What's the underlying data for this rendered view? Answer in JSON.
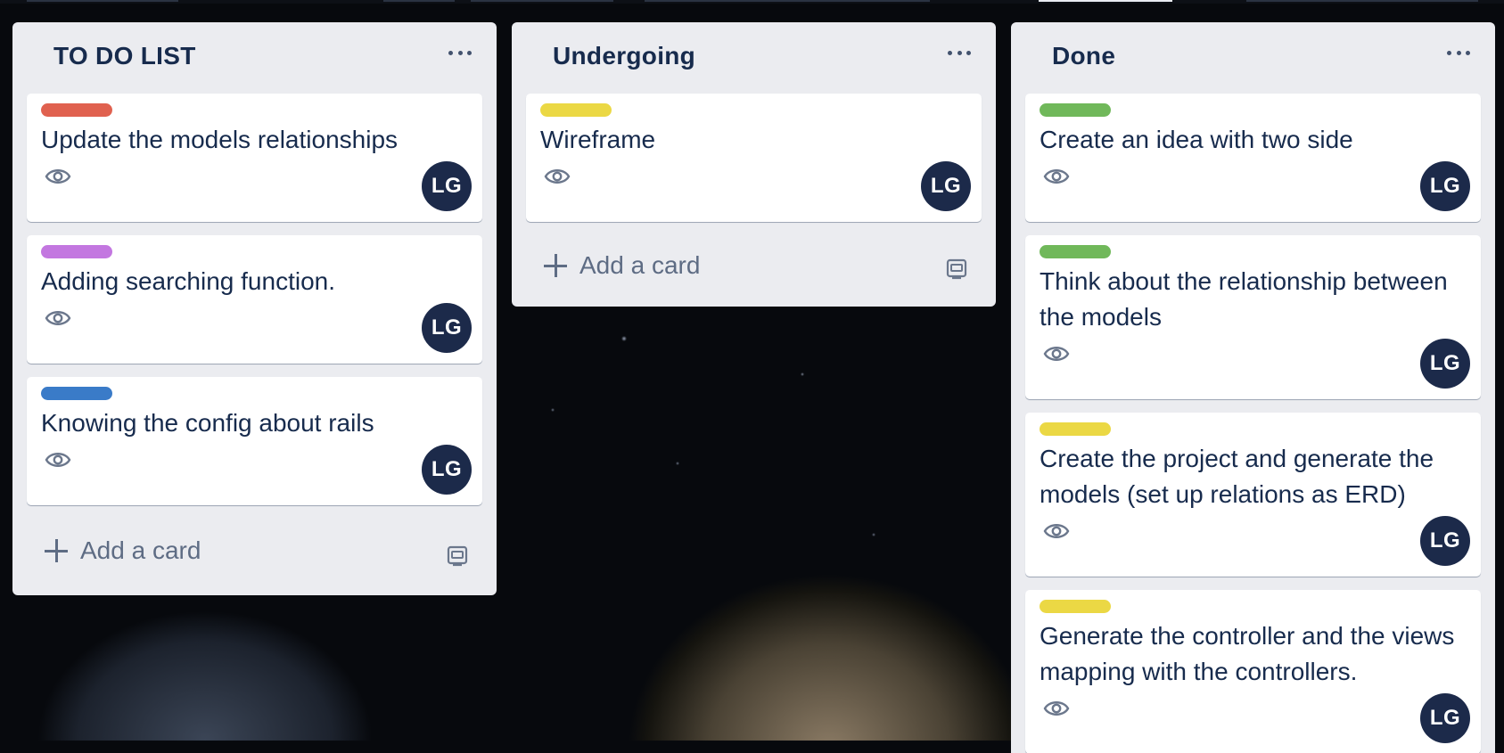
{
  "lists": [
    {
      "title": "TO DO LIST",
      "add_label": "Add a card",
      "cards": [
        {
          "label_color": "#e0614f",
          "title": "Update the models relationships",
          "avatar": "LG"
        },
        {
          "label_color": "#c377e0",
          "title": "Adding searching function.",
          "avatar": "LG"
        },
        {
          "label_color": "#3a7bc8",
          "title": "Knowing the config about rails",
          "avatar": "LG"
        }
      ]
    },
    {
      "title": "Undergoing",
      "add_label": "Add a card",
      "cards": [
        {
          "label_color": "#ebd844",
          "title": "Wireframe",
          "avatar": "LG"
        }
      ]
    },
    {
      "title": "Done",
      "cards": [
        {
          "label_color": "#70b85a",
          "title": "Create an idea with two side",
          "avatar": "LG"
        },
        {
          "label_color": "#70b85a",
          "title": "Think about the relationship between the models",
          "avatar": "LG"
        },
        {
          "label_color": "#ebd844",
          "title": "Create the project and generate the models (set up relations as ERD)",
          "avatar": "LG"
        },
        {
          "label_color": "#ebd844",
          "title": "Generate the controller and the views mapping with the controllers.",
          "avatar": "LG"
        }
      ]
    }
  ],
  "icons": {
    "watch": "eye-icon",
    "menu": "more-horizontal-icon",
    "add": "plus-icon",
    "template": "card-template-icon"
  }
}
